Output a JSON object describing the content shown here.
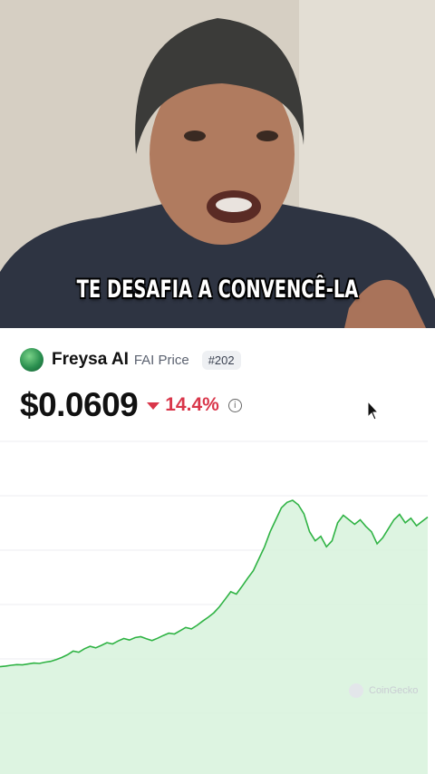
{
  "video": {
    "caption": "TE DESAFIA A CONVENCÊ-LA"
  },
  "coin": {
    "name": "Freysa AI",
    "subtitle": "FAI Price",
    "rank": "#202",
    "price": "$0.0609",
    "change": "14.4%",
    "change_direction": "down",
    "change_color": "#d9364a"
  },
  "chart_data": {
    "type": "area",
    "line_color": "#2fb344",
    "fill_color": "#d7f2dc",
    "grid": true,
    "watermark": "CoinGecko",
    "values": [
      0.011,
      0.0112,
      0.0115,
      0.0117,
      0.0116,
      0.0119,
      0.0122,
      0.0121,
      0.0125,
      0.0128,
      0.0134,
      0.0141,
      0.015,
      0.0162,
      0.0158,
      0.017,
      0.0178,
      0.0173,
      0.0181,
      0.019,
      0.0186,
      0.0196,
      0.0204,
      0.0199,
      0.0207,
      0.021,
      0.0203,
      0.0197,
      0.0205,
      0.0214,
      0.0222,
      0.0219,
      0.023,
      0.0241,
      0.0236,
      0.0248,
      0.0262,
      0.0275,
      0.029,
      0.031,
      0.0335,
      0.036,
      0.0352,
      0.0378,
      0.0405,
      0.043,
      0.047,
      0.051,
      0.056,
      0.06,
      0.064,
      0.0658,
      0.0665,
      0.065,
      0.062,
      0.056,
      0.053,
      0.0545,
      0.051,
      0.053,
      0.059,
      0.0615,
      0.06,
      0.0585,
      0.06,
      0.0578,
      0.056,
      0.052,
      0.054,
      0.057,
      0.06,
      0.0618,
      0.059,
      0.0605,
      0.058,
      0.0595,
      0.0609
    ]
  }
}
